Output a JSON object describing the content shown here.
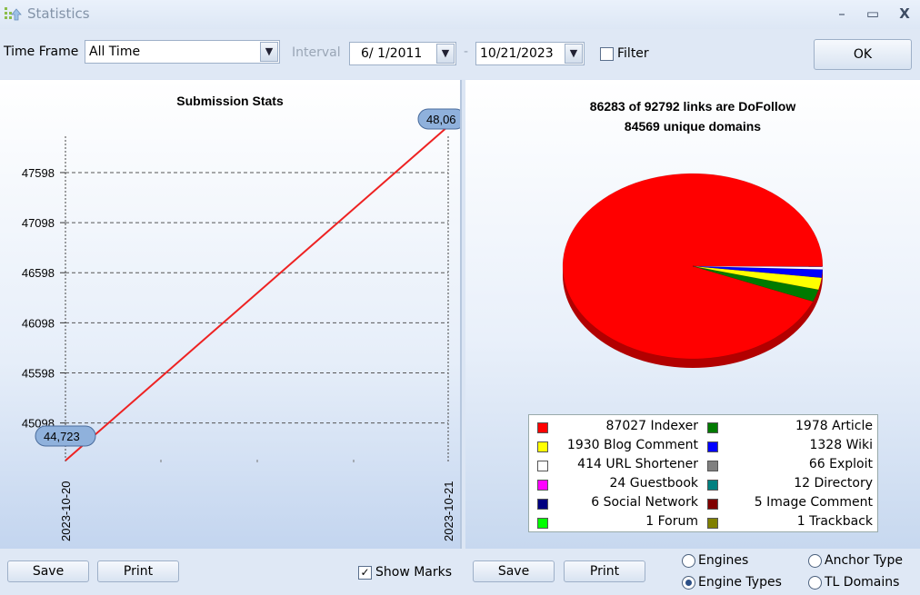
{
  "window": {
    "title": "Statistics",
    "minimize": "–",
    "maximize": "▭",
    "close": "X"
  },
  "toolbar": {
    "timeframe_label": "Time Frame",
    "timeframe_value": "All Time",
    "interval_label": "Interval",
    "date_from": "6/  1/2011",
    "date_sep": "-",
    "date_to": "10/21/2023",
    "filter_label": "Filter",
    "filter_checked": false,
    "ok_label": "OK"
  },
  "chart_data": [
    {
      "type": "line",
      "title": "Submission Stats",
      "x": [
        "2023-10-20",
        "2023-10-21"
      ],
      "series": [
        {
          "values": [
            44723,
            48060
          ],
          "color": "#ee2222"
        }
      ],
      "point_labels": [
        "44,723",
        "48,06"
      ],
      "yticks": [
        45098,
        45598,
        46098,
        46598,
        47098,
        47598
      ],
      "ytick_labels": [
        "45098",
        "45598",
        "46098",
        "46598",
        "47098",
        "47598"
      ],
      "ylim": [
        44623,
        48160
      ],
      "grid": true
    },
    {
      "type": "pie",
      "title_lines": [
        "86283 of 92792 links are DoFollow",
        "84569 unique domains"
      ],
      "slices": [
        {
          "label": "Indexer",
          "value": 87027,
          "color": "#ff0000",
          "legend": "87027 Indexer"
        },
        {
          "label": "Article",
          "value": 1978,
          "color": "#007a00",
          "legend": "1978 Article"
        },
        {
          "label": "Blog Comment",
          "value": 1930,
          "color": "#ffff00",
          "legend": "1930 Blog Comment"
        },
        {
          "label": "Wiki",
          "value": 1328,
          "color": "#0000ff",
          "legend": "1328 Wiki"
        },
        {
          "label": "URL Shortener",
          "value": 414,
          "color": "#ffffff",
          "legend": "414 URL Shortener"
        },
        {
          "label": "Exploit",
          "value": 66,
          "color": "#808080",
          "legend": "66 Exploit"
        },
        {
          "label": "Guestbook",
          "value": 24,
          "color": "#ff00ff",
          "legend": "24 Guestbook"
        },
        {
          "label": "Directory",
          "value": 12,
          "color": "#008080",
          "legend": "12 Directory"
        },
        {
          "label": "Social Network",
          "value": 6,
          "color": "#000080",
          "legend": "6 Social Network"
        },
        {
          "label": "Image Comment",
          "value": 5,
          "color": "#800000",
          "legend": "5 Image Comment"
        },
        {
          "label": "Forum",
          "value": 1,
          "color": "#00ff00",
          "legend": "1 Forum"
        },
        {
          "label": "Trackback",
          "value": 1,
          "color": "#808000",
          "legend": "1 Trackback"
        }
      ]
    }
  ],
  "bottom": {
    "save_left": "Save",
    "print_left": "Print",
    "show_marks_label": "Show Marks",
    "show_marks_checked": true,
    "save_right": "Save",
    "print_right": "Print",
    "radio_engines": "Engines",
    "radio_engine_types": "Engine Types",
    "radio_anchor_type": "Anchor Type",
    "radio_tl_domains": "TL Domains",
    "selected": "Engine Types"
  }
}
